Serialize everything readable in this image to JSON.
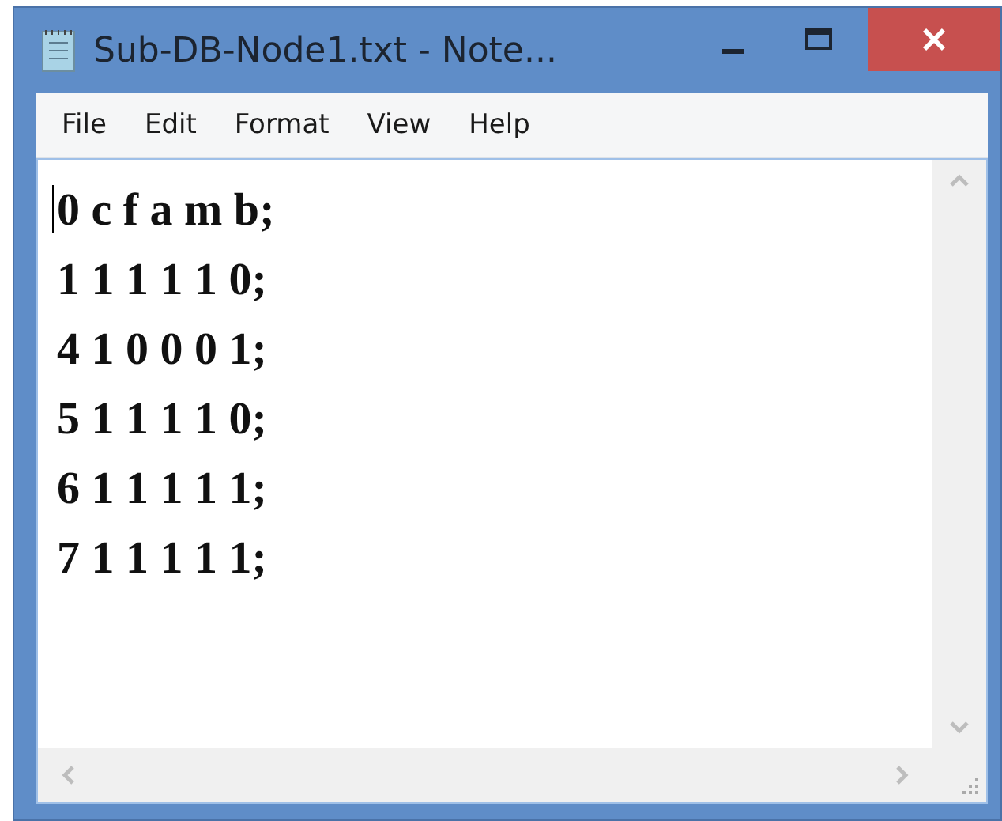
{
  "window": {
    "title": "Sub-DB-Node1.txt - Note..."
  },
  "menu": [
    "File",
    "Edit",
    "Format",
    "View",
    "Help"
  ],
  "document": {
    "lines": [
      "0 c f a m b;",
      "1 1 1 1 1 0;",
      "4 1 0 0 0 1;",
      "5 1 1 1 1 0;",
      "6 1 1 1 1 1;",
      "7 1 1 1 1 1;"
    ]
  }
}
